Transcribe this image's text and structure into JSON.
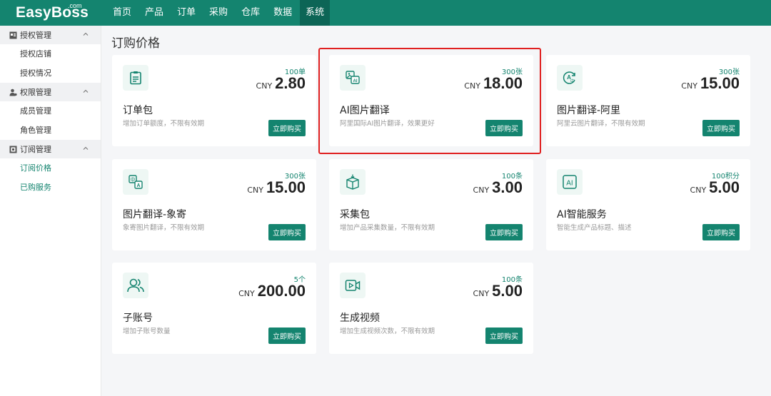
{
  "brand": {
    "name": "EasyBoss",
    "suffix": ".com"
  },
  "nav": [
    "首页",
    "产品",
    "订单",
    "采购",
    "仓库",
    "数据",
    "系统"
  ],
  "nav_active": 6,
  "sidebar": {
    "groups": [
      {
        "title": "授权管理",
        "icon": "store-icon",
        "items": [
          "授权店铺",
          "授权情况"
        ]
      },
      {
        "title": "权限管理",
        "icon": "user-key-icon",
        "items": [
          "成员管理",
          "角色管理"
        ]
      },
      {
        "title": "订阅管理",
        "icon": "subscription-icon",
        "items": [
          "订阅价格",
          "已购服务"
        ]
      }
    ],
    "active_item": "订阅价格"
  },
  "page_title": "订购价格",
  "buy_label": "立即购买",
  "currency": "CNY",
  "products": [
    {
      "name": "订单包",
      "qty": "100单",
      "price": "2.80",
      "desc": "增加订单额度，不限有效期",
      "icon": "clipboard-icon"
    },
    {
      "name": "AI图片翻译",
      "qty": "300张",
      "price": "18.00",
      "desc": "阿里国际AI图片翻译，效果更好",
      "icon": "ai-image-translate-icon"
    },
    {
      "name": "图片翻译-阿里",
      "qty": "300张",
      "price": "15.00",
      "desc": "阿里云图片翻译，不限有效期",
      "icon": "translate-cycle-icon"
    },
    {
      "name": "图片翻译-象寄",
      "qty": "300张",
      "price": "15.00",
      "desc": "象寄图片翻译，不限有效期",
      "icon": "translate-icon"
    },
    {
      "name": "采集包",
      "qty": "100条",
      "price": "3.00",
      "desc": "增加产品采集数量，不限有效期",
      "icon": "box-download-icon"
    },
    {
      "name": "AI智能服务",
      "qty": "100积分",
      "price": "5.00",
      "desc": "智能生成产品标题、描述",
      "icon": "ai-icon"
    },
    {
      "name": "子账号",
      "qty": "5个",
      "price": "200.00",
      "desc": "增加子账号数量",
      "icon": "users-icon"
    },
    {
      "name": "生成视频",
      "qty": "100条",
      "price": "5.00",
      "desc": "增加生成视频次数，不限有效期",
      "icon": "video-icon"
    }
  ],
  "colors": {
    "brand": "#14846f",
    "brand_dark": "#0c6556",
    "highlight": "#e02020"
  }
}
